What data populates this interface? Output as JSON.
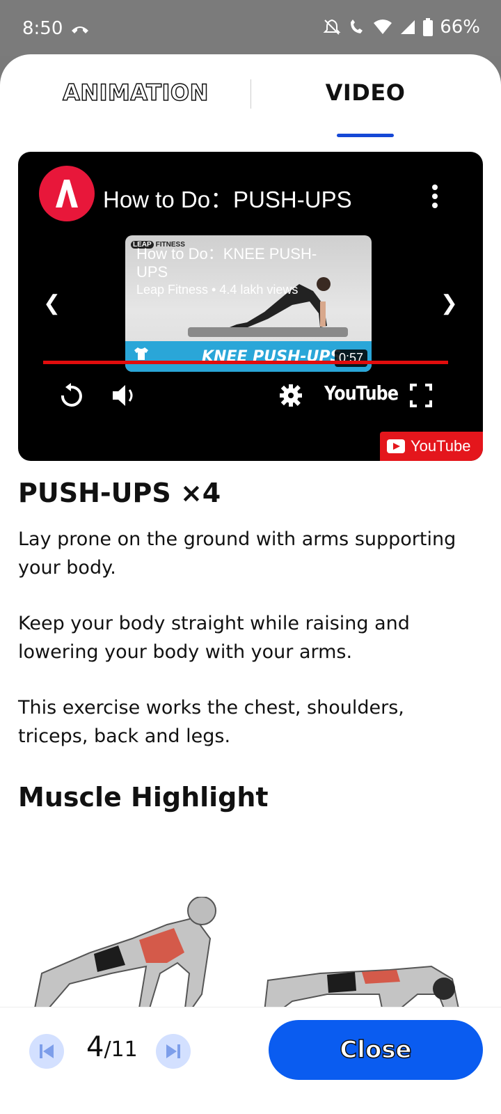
{
  "status": {
    "time": "8:50",
    "battery": "66%"
  },
  "tabs": {
    "animation": "ANIMATION",
    "video": "VIDEO",
    "active": "VIDEO"
  },
  "video": {
    "title": "How to Do：PUSH-UPS",
    "card": {
      "brand_mark": "LEAP",
      "brand_text": "FITNESS",
      "title": "How to Do：KNEE PUSH-UPS",
      "subtitle": "Leap Fitness • 4.4 lakh views",
      "band_label": "KNEE PUSH-UPS",
      "duration": "0:57"
    },
    "youtube_word": "YouTube",
    "youtube_badge": "YouTube",
    "accent": "#e10d0d"
  },
  "exercise": {
    "title": "PUSH-UPS ×4",
    "paragraphs": [
      "Lay prone on the ground with arms supporting your body.",
      "Keep your body straight while raising and lowering your body with your arms.",
      "This exercise works the chest, shoulders, triceps, back and legs."
    ]
  },
  "muscle": {
    "title": "Muscle Highlight"
  },
  "footer": {
    "current": "4",
    "total": "/11",
    "close_label": "Close",
    "accent": "#0a5cf0"
  }
}
